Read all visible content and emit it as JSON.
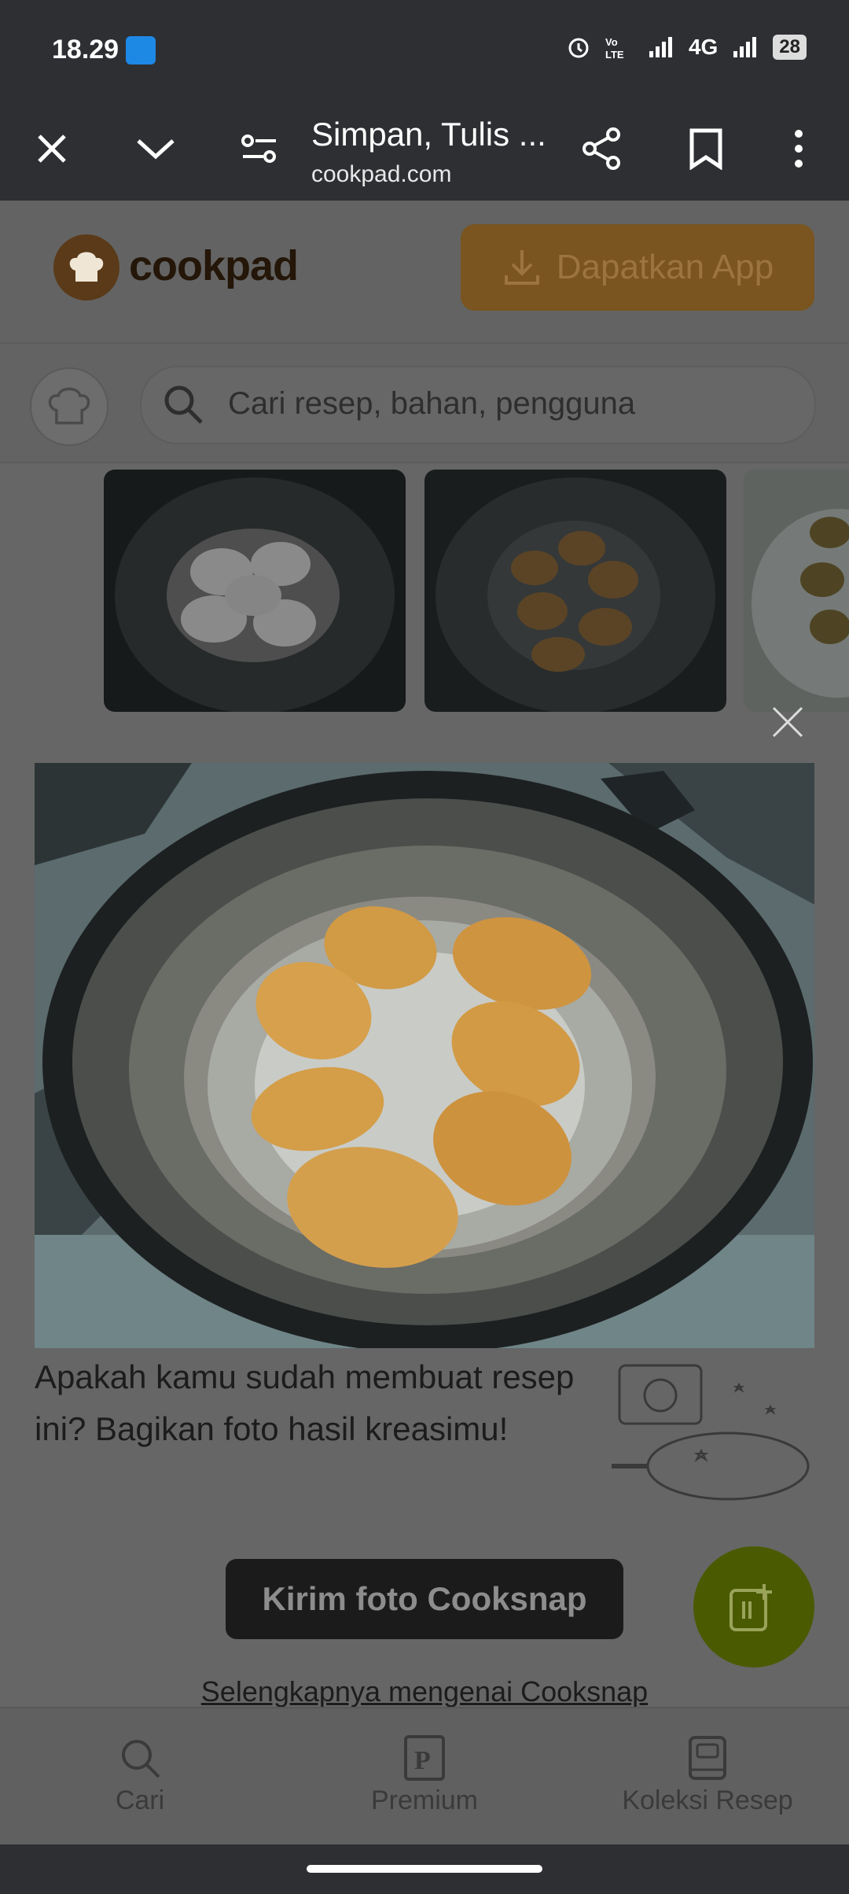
{
  "status": {
    "time": "18.29",
    "network": "4G",
    "battery": "28"
  },
  "toolbar": {
    "title": "Simpan, Tulis ...",
    "url": "cookpad.com"
  },
  "header": {
    "logo": "cookpad",
    "download_label": "Dapatkan App"
  },
  "search": {
    "placeholder": "Cari resep, bahan, pengguna"
  },
  "modal": {
    "prompt": "Apakah kamu sudah membuat resep ini? Bagikan foto hasil kreasimu!",
    "send_label": "Kirim foto Cooksnap",
    "more_link": "Selengkapnya mengenai Cooksnap"
  },
  "nav": {
    "items": [
      {
        "label": "Cari",
        "icon": "search-icon"
      },
      {
        "label": "Premium",
        "icon": "premium-icon"
      },
      {
        "label": "Koleksi Resep",
        "icon": "collection-icon"
      }
    ]
  },
  "colors": {
    "toolbar": "#2d2f33",
    "fab": "#4a5a00",
    "overlay": "#666666"
  }
}
